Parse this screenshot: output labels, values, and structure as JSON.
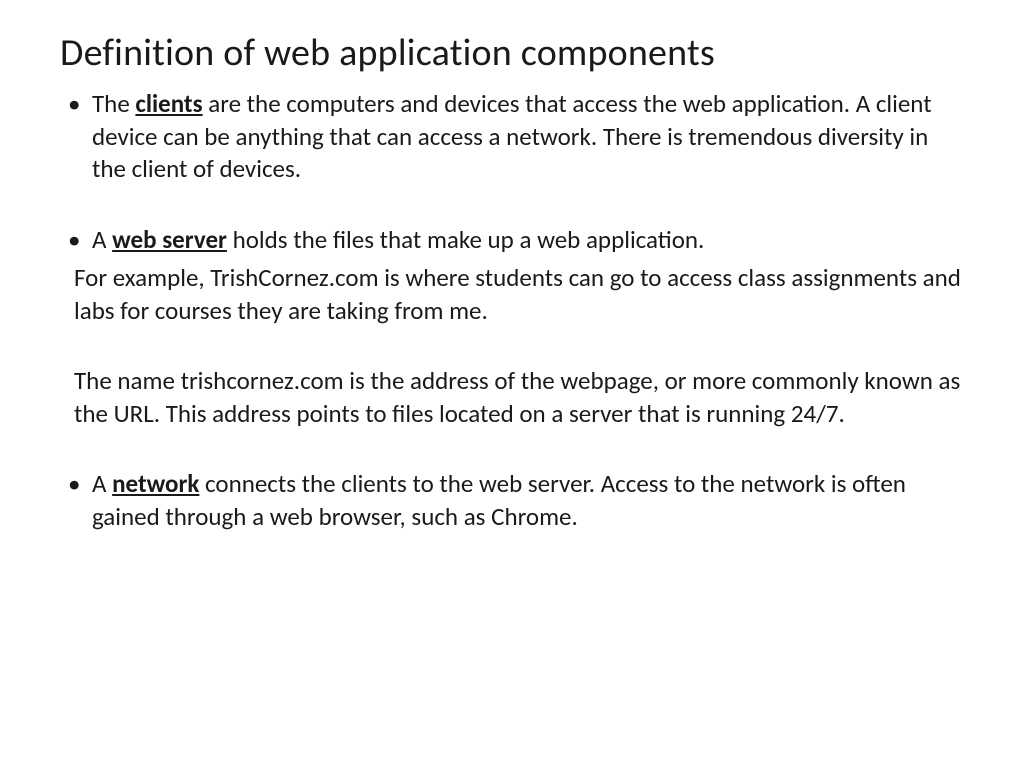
{
  "title": "Definition of web application components",
  "bullets": {
    "b1_pre": "The ",
    "b1_term": "clients",
    "b1_post": " are the computers and devices that access the web application.   A client device can be anything that can access a network.  There is tremendous diversity in the client of devices.",
    "b2_pre": "A ",
    "b2_term": "web server",
    "b2_post": " holds the files that make up a web application.",
    "b2_cont1": " For example, TrishCornez.com is where students can go to access class assignments and labs for courses they are taking from me.",
    "b2_cont2": "The name trishcornez.com is the address of the webpage, or more commonly known as the URL. This address points to files located on a server that is running 24/7.",
    "b3_pre": "A ",
    "b3_term": "network",
    "b3_post": " connects the clients to the web server. Access to the network is often gained through a web browser, such as Chrome."
  }
}
